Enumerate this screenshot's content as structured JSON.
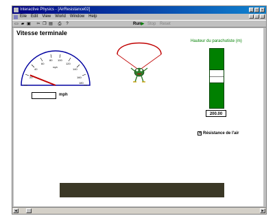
{
  "window": {
    "title": "Interactive Physics - [AirResistance02]",
    "controls": [
      "_",
      "□",
      "×"
    ]
  },
  "menubar": {
    "items": [
      "Eile",
      "Edit",
      "View",
      "World",
      "Window",
      "Help"
    ]
  },
  "toolbar": {
    "icons": [
      "new-icon",
      "open-icon",
      "save-icon",
      "cut-icon",
      "copy-icon",
      "paste-icon",
      "print-icon",
      "help-icon"
    ],
    "run_label": "Run",
    "stop_label": "Stop",
    "reset_label": "Reset"
  },
  "simulation": {
    "heading": "Vitesse terminale",
    "speedometer": {
      "ticks": [
        "20",
        "40",
        "60",
        "80",
        "100",
        "120",
        "140",
        "160",
        "180"
      ],
      "unit_small": "mph",
      "reading_fraction": 0.12
    },
    "speed_value": "",
    "speed_unit": "mph",
    "height_label": "Hauteur du parachutiste (m)",
    "height_value": "200.00",
    "height_fraction": 0.55,
    "air_resistance": {
      "label": "Résistance de l'air",
      "checked": true
    }
  },
  "colors": {
    "gauge_green": "#008000",
    "ground": "#3b3826",
    "speedometer_outline": "#0000a0",
    "parachute": "#c00000"
  }
}
